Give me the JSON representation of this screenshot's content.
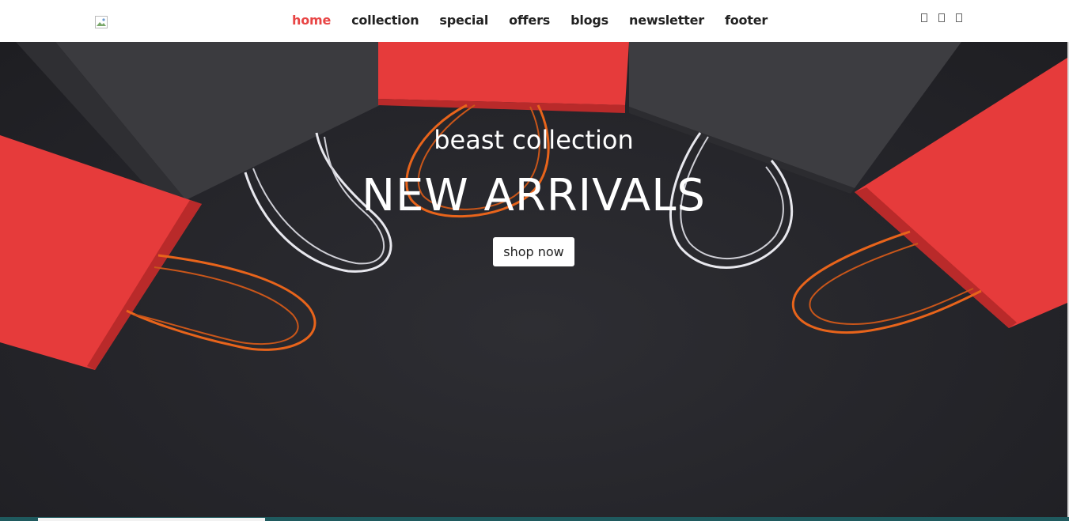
{
  "nav": {
    "links": [
      "home",
      "collection",
      "special",
      "offers",
      "blogs",
      "newsletter",
      "footer"
    ],
    "active": "home",
    "icons": [
      "search-icon",
      "cart-icon",
      "user-icon"
    ]
  },
  "hero": {
    "subtitle": "beast collection",
    "title": "NEW ARRIVALS",
    "button_label": "shop now"
  },
  "colors": {
    "accent": "#e84545",
    "nav_text": "#222222",
    "hero_bg": "#25252a",
    "bag_red": "#e63b3b",
    "bag_black": "#3a3a3e",
    "string_orange": "#e8641b",
    "string_white": "#e8e8ee"
  }
}
